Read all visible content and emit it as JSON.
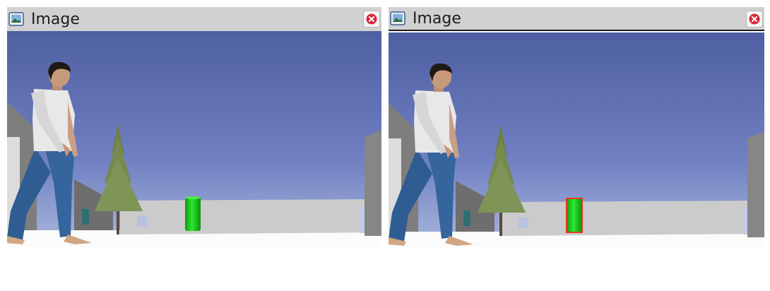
{
  "windows": [
    {
      "title": "Image",
      "icon": "image-icon",
      "close_icon": "close-icon"
    },
    {
      "title": "Image",
      "icon": "image-icon",
      "close_icon": "close-icon"
    }
  ],
  "scene_elements": [
    "walking-person",
    "pine-tree",
    "green-cylinder",
    "buildings",
    "ground",
    "sky"
  ],
  "colors": {
    "sky_top": "#4e5fa2",
    "sky_bottom": "#a9b7dc",
    "cylinder": "#1bcf1b",
    "detection_outline": "#e03a1a",
    "titlebar": "#d1d1d1"
  }
}
